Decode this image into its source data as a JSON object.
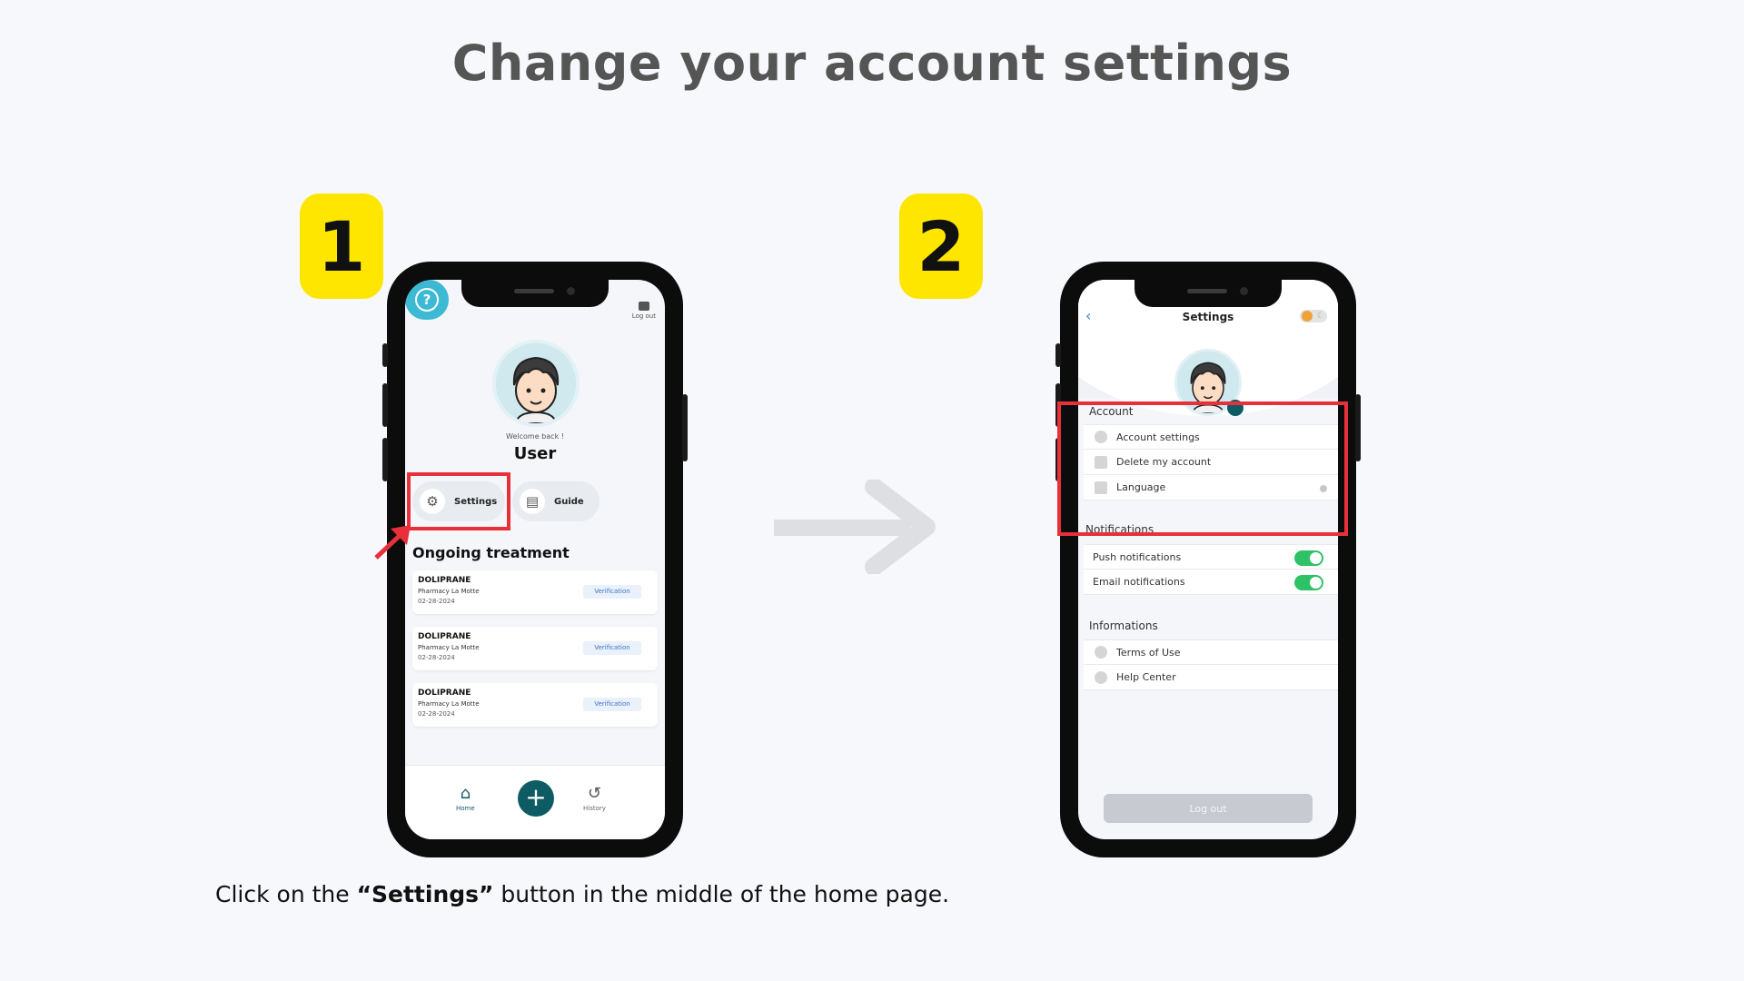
{
  "page": {
    "title": "Change your account settings",
    "step1": "1",
    "step2": "2",
    "caption_pre": "Click on the ",
    "caption_bold": "“Settings”",
    "caption_post": " button in the middle of the home page."
  },
  "home_screen": {
    "logout_label": "Log out",
    "welcome": "Welcome back !",
    "user_name": "User",
    "settings_label": "Settings",
    "guide_label": "Guide",
    "help_icon": "question-circle-icon",
    "section_title": "Ongoing treatment",
    "treatments": [
      {
        "name": "DOLIPRANE",
        "pharmacy": "Pharmacy La Motte",
        "date": "02-28-2024",
        "status": "Verification"
      },
      {
        "name": "DOLIPRANE",
        "pharmacy": "Pharmacy La Motte",
        "date": "02-28-2024",
        "status": "Verification"
      },
      {
        "name": "DOLIPRANE",
        "pharmacy": "Pharmacy La Motte",
        "date": "02-28-2024",
        "status": "Verification"
      }
    ],
    "nav": {
      "home": "Home",
      "plus": "+",
      "history": "History"
    }
  },
  "settings_screen": {
    "title": "Settings",
    "account": {
      "label": "Account",
      "items": [
        "Account settings",
        "Delete my account",
        "Language"
      ]
    },
    "notifications": {
      "label": "Notifications",
      "items": [
        "Push notifications",
        "Email notifications"
      ]
    },
    "informations": {
      "label": "Informations",
      "items": [
        "Terms of Use",
        "Help Center"
      ]
    },
    "logout_button": "Log out"
  },
  "colors": {
    "accent_yellow": "#ffe600",
    "highlight_red": "#e8303a",
    "teal": "#0d5b63",
    "help_blue": "#3cb9d3",
    "toggle_green": "#2ec267"
  }
}
